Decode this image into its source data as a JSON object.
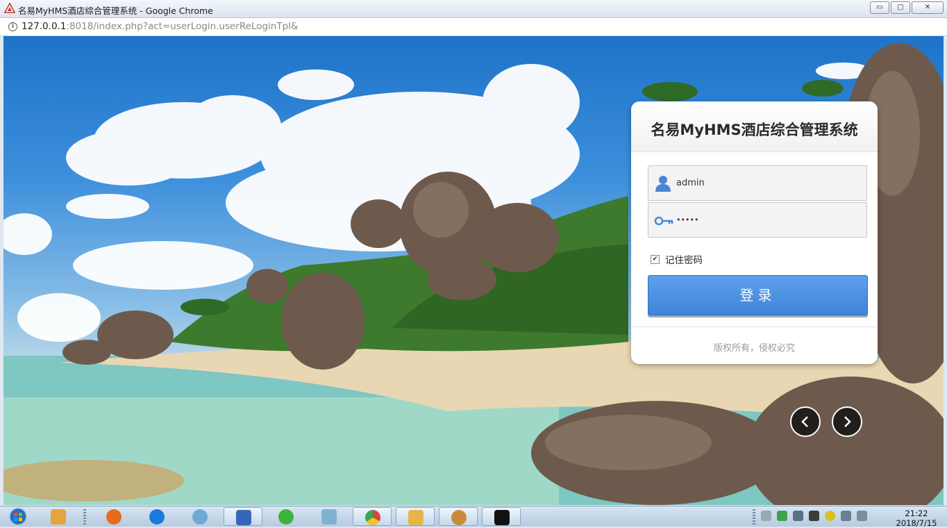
{
  "window": {
    "title": "名易MyHMS酒店综合管理系统 - Google Chrome",
    "minimize": "▭",
    "maximize": "□",
    "close": "✕"
  },
  "addressbar": {
    "host": "127.0.0.1",
    "path": ":8018/index.php?act=userLogin.userReLoginTpl&"
  },
  "login": {
    "title": "名易MyHMS酒店综合管理系统",
    "username_value": "admin",
    "password_value": "•••••",
    "remember_label": "记住密码",
    "remember_checked": true,
    "submit_label": "登录",
    "copyright": "版权所有，侵权必究"
  },
  "carousel": {
    "prev_icon": "chevron-left-icon",
    "next_icon": "chevron-right-icon"
  },
  "taskbar": {
    "items": [
      {
        "name": "windows-start-icon"
      },
      {
        "name": "app-icon-1",
        "color": "#e7a33c"
      },
      {
        "name": "firefox-icon",
        "color": "#e86a1c"
      },
      {
        "name": "kugou-icon",
        "color": "#1a7ad9"
      },
      {
        "name": "safari-icon",
        "color": "#6fa9d6"
      },
      {
        "name": "remote-desktop-icon",
        "color": "#3567b8"
      },
      {
        "name": "wechat-icon",
        "color": "#3fb23c"
      },
      {
        "name": "notepad-icon",
        "color": "#7fb2cf"
      },
      {
        "name": "chrome-icon",
        "color": "#d9463c"
      },
      {
        "name": "explorer-icon",
        "color": "#e6b54a"
      },
      {
        "name": "paint-icon",
        "color": "#c98a3c"
      },
      {
        "name": "cmd-icon",
        "color": "#111111"
      }
    ],
    "clock_time": "21:22",
    "clock_date": "2018/7/15"
  }
}
